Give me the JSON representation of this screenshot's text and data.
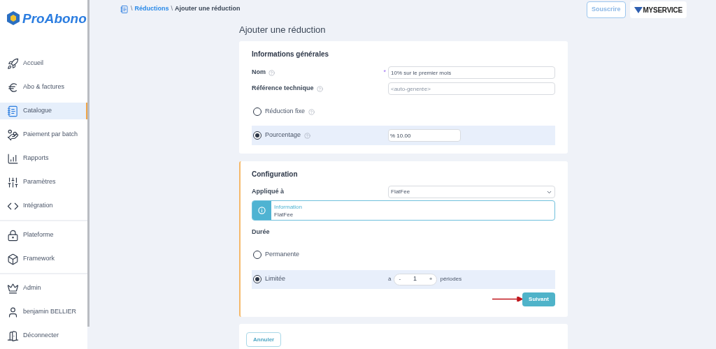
{
  "logo": {
    "text": "ProAbono"
  },
  "sidebar": {
    "groups": [
      [
        {
          "label": "Accueil",
          "selected": false
        },
        {
          "label": "Abo & factures",
          "selected": false
        },
        {
          "label": "Catalogue",
          "selected": true
        },
        {
          "label": "Paiement par batch",
          "selected": false
        },
        {
          "label": "Rapports",
          "selected": false
        },
        {
          "label": "Paramètres",
          "selected": false
        },
        {
          "label": "Intégration",
          "selected": false
        }
      ],
      [
        {
          "label": "Plateforme",
          "selected": false
        },
        {
          "label": "Framework",
          "selected": false
        }
      ],
      [
        {
          "label": "Admin",
          "selected": false
        },
        {
          "label": "benjamin BELLIER",
          "selected": false
        },
        {
          "label": "Déconnecter",
          "selected": false
        }
      ]
    ]
  },
  "breadcrumb": [
    {
      "kind": "separator",
      "text": "\\"
    },
    {
      "kind": "link",
      "text": "Réductions"
    },
    {
      "kind": "separator",
      "text": "\\"
    },
    {
      "kind": "current",
      "text": "Ajouter une réduction"
    }
  ],
  "header": {
    "subscribe": "Souscrire",
    "brand": "MYSERVICE"
  },
  "page_title": "Ajouter une réduction",
  "general": {
    "title": "Informations générales",
    "name": {
      "label": "Nom",
      "required": "*",
      "value": "10% sur le premier mois"
    },
    "reference": {
      "label": "Référence technique",
      "placeholder": "<auto-generée>"
    },
    "options": [
      {
        "label": "Réduction fixe",
        "selected": false
      },
      {
        "label": "Pourcentage",
        "selected": true,
        "value": "% 10.00"
      }
    ]
  },
  "config": {
    "title": "Configuration",
    "applied_label": "Appliqué à",
    "applied_value": "FlatFee",
    "info": {
      "title": "Information",
      "text": "FlatFee"
    },
    "duration_label": "Durée",
    "durations": [
      {
        "label": "Permanente",
        "selected": false
      },
      {
        "label": "Limitée",
        "selected": true,
        "prefix": "à",
        "minus": "-",
        "count": "1",
        "plus": "+",
        "suffix": "périodes"
      }
    ],
    "next": "Suivant"
  },
  "cancel": "Annuler"
}
